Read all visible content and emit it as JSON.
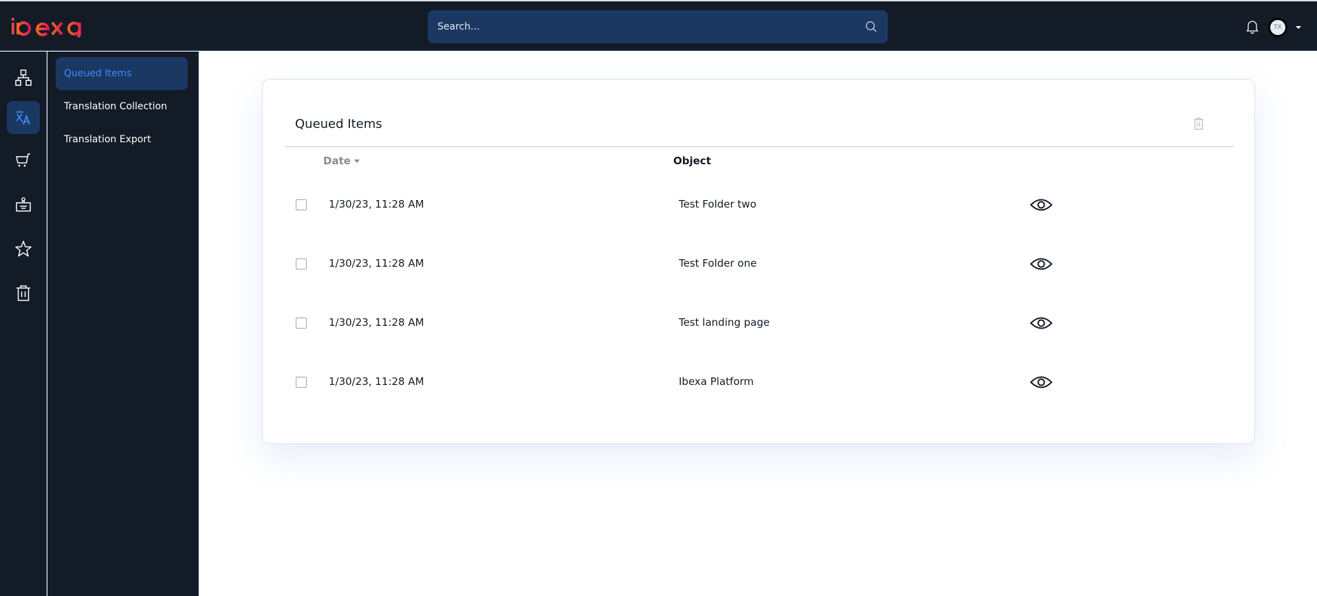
{
  "app": {
    "brand": "ibexa",
    "brand_colors": {
      "start": "#f26522",
      "end": "#e3165b"
    }
  },
  "header": {
    "search": {
      "placeholder": "Search...",
      "value": ""
    },
    "notifications_icon": "bell-icon",
    "user": {
      "initials": "TX"
    }
  },
  "rail": {
    "items": [
      {
        "name": "content-structure",
        "icon": "sitemap-icon",
        "active": false
      },
      {
        "name": "translation",
        "icon": "translate-icon",
        "active": true
      },
      {
        "name": "commerce",
        "icon": "cart-icon",
        "active": false
      },
      {
        "name": "admin",
        "icon": "admin-panel-icon",
        "active": false
      },
      {
        "name": "bookmarks",
        "icon": "star-icon",
        "active": false
      },
      {
        "name": "trash",
        "icon": "trash-icon",
        "active": false
      }
    ]
  },
  "submenu": {
    "items": [
      {
        "label": "Queued Items",
        "active": true
      },
      {
        "label": "Translation Collection",
        "active": false
      },
      {
        "label": "Translation Export",
        "active": false
      }
    ]
  },
  "main": {
    "title": "Queued Items",
    "columns": {
      "date": "Date",
      "object": "Object"
    },
    "sort": {
      "column": "date",
      "direction": "desc"
    },
    "rows": [
      {
        "date": "1/30/23, 11:28 AM",
        "object": "Test Folder two"
      },
      {
        "date": "1/30/23, 11:28 AM",
        "object": "Test Folder one"
      },
      {
        "date": "1/30/23, 11:28 AM",
        "object": "Test landing page"
      },
      {
        "date": "1/30/23, 11:28 AM",
        "object": "Ibexa Platform"
      }
    ]
  },
  "colors": {
    "header_bg": "#131b26",
    "active_bg": "#1a3862",
    "active_text": "#3d8cf7"
  }
}
